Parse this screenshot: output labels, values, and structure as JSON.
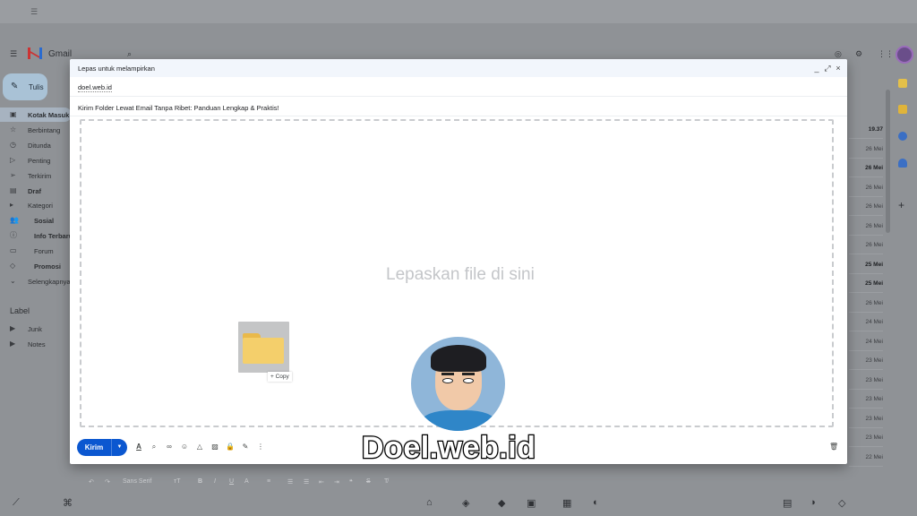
{
  "gmail": {
    "app_name": "Gmail",
    "compose_button": "Tulis",
    "nav": [
      {
        "label": "Kotak Masuk",
        "icon": "inbox-icon",
        "glyph": "▣",
        "active": true,
        "bold": true
      },
      {
        "label": "Berbintang",
        "icon": "star-icon",
        "glyph": "☆",
        "active": false,
        "bold": false
      },
      {
        "label": "Ditunda",
        "icon": "clock-icon",
        "glyph": "◷",
        "active": false,
        "bold": false
      },
      {
        "label": "Penting",
        "icon": "important-icon",
        "glyph": "▷",
        "active": false,
        "bold": false
      },
      {
        "label": "Terkirim",
        "icon": "send-icon",
        "glyph": "➢",
        "active": false,
        "bold": false
      },
      {
        "label": "Draf",
        "icon": "draft-icon",
        "glyph": "▤",
        "active": false,
        "bold": true
      },
      {
        "label": "Kategori",
        "icon": "category-icon",
        "glyph": "▸",
        "active": false,
        "bold": false
      },
      {
        "label": "Sosial",
        "icon": "people-icon",
        "glyph": "👥",
        "active": false,
        "bold": true
      },
      {
        "label": "Info Terbaru",
        "icon": "info-icon",
        "glyph": "ⓘ",
        "active": false,
        "bold": true
      },
      {
        "label": "Forum",
        "icon": "forum-icon",
        "glyph": "▭",
        "active": false,
        "bold": false
      },
      {
        "label": "Promosi",
        "icon": "tag-icon",
        "glyph": "◇",
        "active": false,
        "bold": true
      },
      {
        "label": "Selengkapnya",
        "icon": "chevron-down-icon",
        "glyph": "⌄",
        "active": false,
        "bold": false
      }
    ],
    "label_heading": "Label",
    "labels": [
      {
        "label": "Junk",
        "icon": "label-icon",
        "glyph": "▶"
      },
      {
        "label": "Notes",
        "icon": "label-icon",
        "glyph": "▶"
      }
    ],
    "dates": [
      {
        "text": "19.37",
        "bold": true
      },
      {
        "text": "26 Mei",
        "bold": false
      },
      {
        "text": "26 Mei",
        "bold": true
      },
      {
        "text": "26 Mei",
        "bold": false
      },
      {
        "text": "26 Mei",
        "bold": false
      },
      {
        "text": "26 Mei",
        "bold": false
      },
      {
        "text": "26 Mei",
        "bold": false
      },
      {
        "text": "25 Mei",
        "bold": true
      },
      {
        "text": "25 Mei",
        "bold": true
      },
      {
        "text": "26 Mei",
        "bold": false
      },
      {
        "text": "24 Mei",
        "bold": false
      },
      {
        "text": "24 Mei",
        "bold": false
      },
      {
        "text": "23 Mei",
        "bold": false
      },
      {
        "text": "23 Mei",
        "bold": false
      },
      {
        "text": "23 Mei",
        "bold": false
      },
      {
        "text": "23 Mei",
        "bold": false
      },
      {
        "text": "23 Mei",
        "bold": false
      },
      {
        "text": "22 Mei",
        "bold": false
      }
    ]
  },
  "compose": {
    "title": "Lepas untuk melampirkan",
    "minimize_glyph": "_",
    "expand_glyph": "⤢",
    "close_glyph": "×",
    "to_value": "doel.web.id",
    "subject_value": "Kirim Folder Lewat Email Tanpa Ribet: Panduan Lengkap & Praktis!",
    "drop_text": "Lepaskan file di sini",
    "drag_copy_label": "+ Copy",
    "format_font": "Sans Serif",
    "send_label": "Kirim",
    "send_more_glyph": "▼",
    "toolbar_icons": [
      {
        "name": "text-format-icon",
        "glyph": "A"
      },
      {
        "name": "attach-icon",
        "glyph": "⌕"
      },
      {
        "name": "link-icon",
        "glyph": "∞"
      },
      {
        "name": "emoji-icon",
        "glyph": "☺"
      },
      {
        "name": "drive-icon",
        "glyph": "△"
      },
      {
        "name": "photo-icon",
        "glyph": "▨"
      },
      {
        "name": "lock-icon",
        "glyph": "🔒"
      },
      {
        "name": "signature-icon",
        "glyph": "✎"
      },
      {
        "name": "more-options-icon",
        "glyph": "⋮"
      }
    ],
    "trash_glyph": "🗑"
  },
  "watermark": {
    "text": "Doel.web.id"
  },
  "colors": {
    "send_button": "#0b57d0",
    "folder": "#f4cf6b",
    "dimmed_background": "#8f9296"
  }
}
